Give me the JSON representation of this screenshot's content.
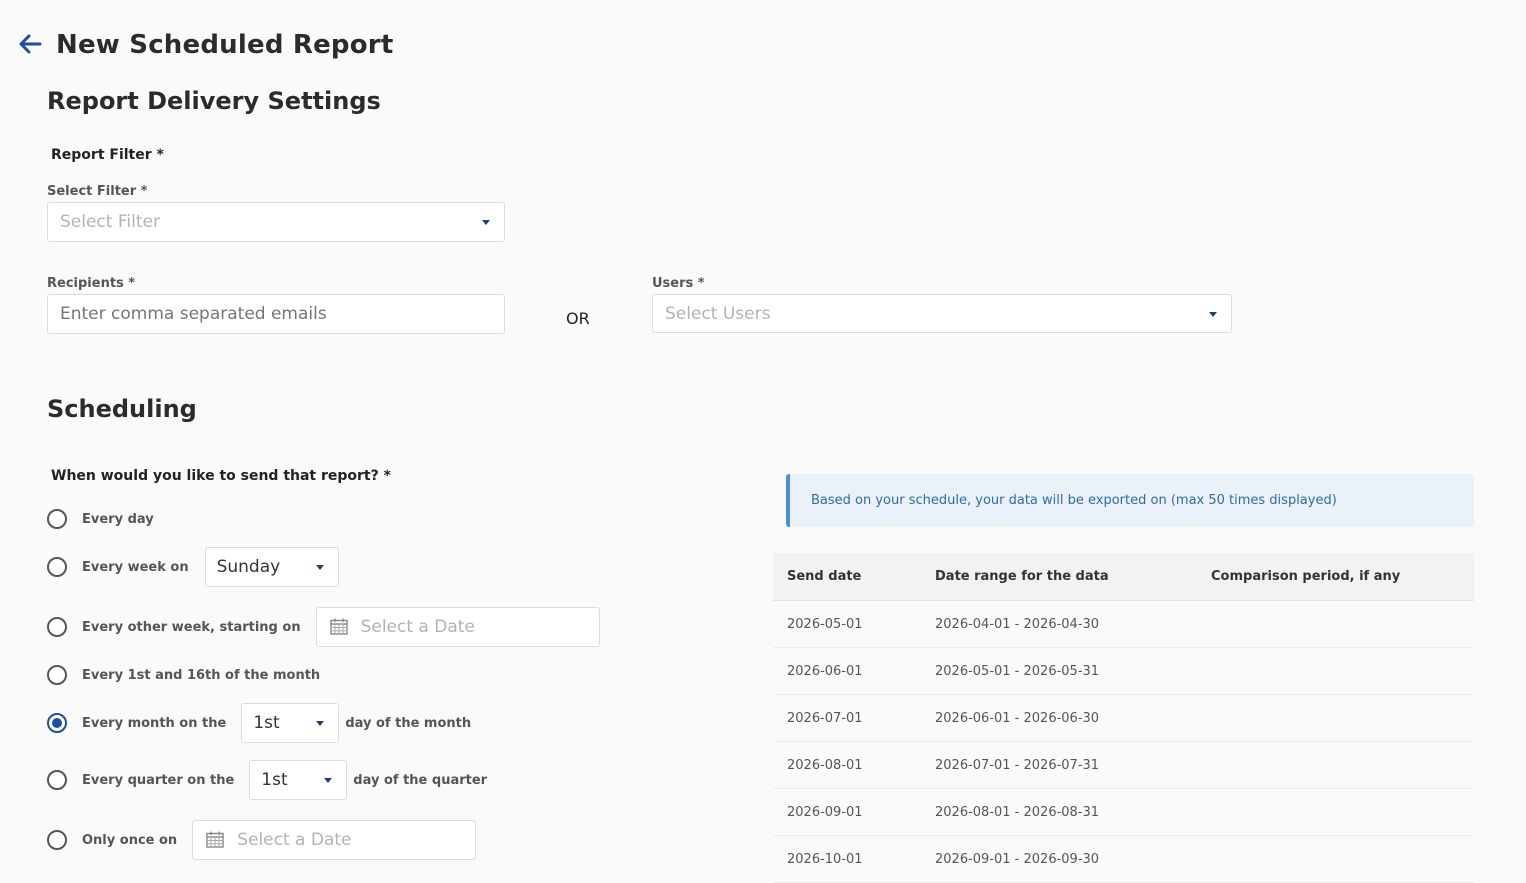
{
  "page": {
    "title": "New Scheduled Report"
  },
  "delivery": {
    "section_title": "Report Delivery Settings",
    "report_filter_label": "Report Filter *",
    "select_filter_label": "Select Filter *",
    "select_filter_placeholder": "Select Filter",
    "recipients_label": "Recipients *",
    "recipients_placeholder": "Enter comma separated emails",
    "or_text": "OR",
    "users_label": "Users *",
    "users_placeholder": "Select Users"
  },
  "scheduling": {
    "section_title": "Scheduling",
    "question": "When would you like to send that report? *",
    "options": {
      "every_day": "Every day",
      "every_week": "Every week on",
      "every_week_value": "Sunday",
      "every_other_week": "Every other week, starting on",
      "every_other_week_placeholder": "Select a Date",
      "first_sixteenth": "Every 1st and 16th of the month",
      "every_month": "Every month on the",
      "every_month_value": "1st",
      "every_month_suffix": "day of the month",
      "every_quarter": "Every quarter on the",
      "every_quarter_value": "1st",
      "every_quarter_suffix": "day of the quarter",
      "only_once": "Only once on",
      "only_once_placeholder": "Select a Date"
    },
    "selected_option": "every_month"
  },
  "preview": {
    "info_text": "Based on your schedule, your data will be exported on (max 50 times displayed)",
    "columns": [
      "Send date",
      "Date range for the data",
      "Comparison period, if any"
    ],
    "rows": [
      [
        "2026-05-01",
        "2026-04-01 - 2026-04-30",
        ""
      ],
      [
        "2026-06-01",
        "2026-05-01 - 2026-05-31",
        ""
      ],
      [
        "2026-07-01",
        "2026-06-01 - 2026-06-30",
        ""
      ],
      [
        "2026-08-01",
        "2026-07-01 - 2026-07-31",
        ""
      ],
      [
        "2026-09-01",
        "2026-08-01 - 2026-08-31",
        ""
      ],
      [
        "2026-10-01",
        "2026-09-01 - 2026-09-30",
        ""
      ]
    ]
  },
  "colors": {
    "accent": "#1c4fa1",
    "info_bg": "#eaf1f8",
    "info_text": "#2d6da8"
  }
}
